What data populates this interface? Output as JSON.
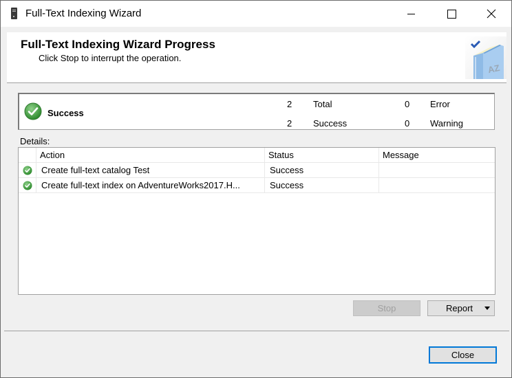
{
  "window": {
    "title": "Full-Text Indexing Wizard",
    "icon": "server-icon",
    "controls": [
      "minimize",
      "maximize",
      "close"
    ]
  },
  "header": {
    "title": "Full-Text Indexing Wizard Progress",
    "subtitle": "Click Stop to interrupt the operation.",
    "icon": "book-az-check-icon"
  },
  "summary": {
    "status": "Success",
    "status_icon": "success-check-icon",
    "stats": [
      {
        "value": "2",
        "label": "Total"
      },
      {
        "value": "2",
        "label": "Success"
      },
      {
        "value": "0",
        "label": "Error"
      },
      {
        "value": "0",
        "label": "Warning"
      }
    ]
  },
  "details": {
    "label": "Details:",
    "columns": [
      "",
      "Action",
      "Status",
      "Message"
    ],
    "rows": [
      {
        "icon": "success-check-icon",
        "action": "Create full-text catalog Test",
        "status": "Success",
        "message": ""
      },
      {
        "icon": "success-check-icon",
        "action": "Create full-text index on AdventureWorks2017.H...",
        "status": "Success",
        "message": ""
      }
    ]
  },
  "buttons": {
    "stop": "Stop",
    "report": "Report",
    "close": "Close"
  },
  "colors": {
    "accent": "#0078d7",
    "success": "#3c9a3c"
  }
}
